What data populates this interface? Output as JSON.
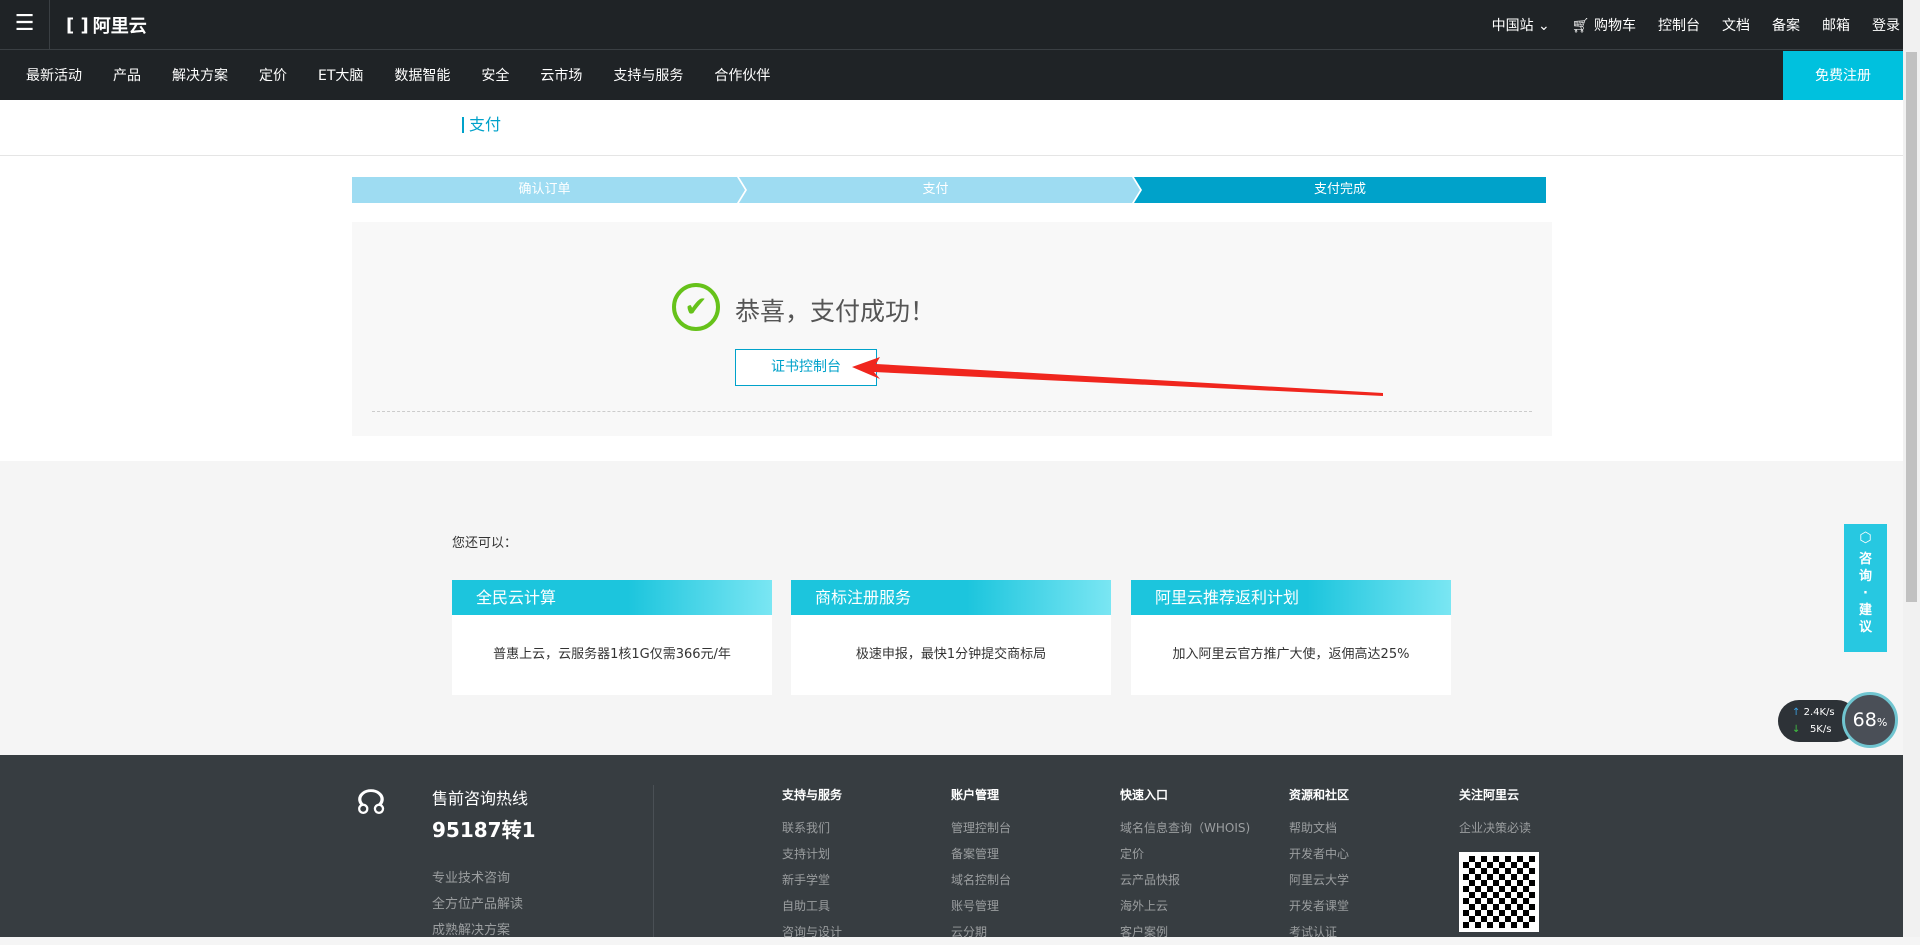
{
  "header": {
    "brand": "阿里云",
    "right_items": [
      "中国站",
      "购物车",
      "控制台",
      "文档",
      "备案",
      "邮箱",
      "登录"
    ],
    "nav": [
      "最新活动",
      "产品",
      "解决方案",
      "定价",
      "ET大脑",
      "数据智能",
      "安全",
      "云市场",
      "支持与服务",
      "合作伙伴"
    ],
    "register": "免费注册"
  },
  "page_title": "支付",
  "steps": [
    "确认订单",
    "支付",
    "支付完成"
  ],
  "success": {
    "message": "恭喜，支付成功！",
    "button": "证书控制台"
  },
  "also_label": "您还可以：",
  "cards": [
    {
      "title": "全民云计算",
      "desc": "普惠上云，云服务器1核1G仅需366元/年"
    },
    {
      "title": "商标注册服务",
      "desc": "极速申报，最快1分钟提交商标局"
    },
    {
      "title": "阿里云推荐返利计划",
      "desc": "加入阿里云官方推广大使，返佣高达25%"
    }
  ],
  "footer": {
    "hotline_label": "售前咨询热线",
    "hotline": "95187转1",
    "links": [
      "专业技术咨询",
      "全方位产品解读",
      "成熟解决方案"
    ],
    "columns": [
      {
        "title": "支持与服务",
        "items": [
          "联系我们",
          "支持计划",
          "新手学堂",
          "自助工具",
          "咨询与设计"
        ]
      },
      {
        "title": "账户管理",
        "items": [
          "管理控制台",
          "备案管理",
          "域名控制台",
          "账号管理",
          "云分期"
        ]
      },
      {
        "title": "快速入口",
        "items": [
          "域名信息查询（WHOIS)",
          "定价",
          "云产品快报",
          "海外上云",
          "客户案例"
        ]
      },
      {
        "title": "资源和社区",
        "items": [
          "帮助文档",
          "开发者中心",
          "阿里云大学",
          "开发者课堂",
          "考试认证"
        ]
      },
      {
        "title": "关注阿里云",
        "items": [
          "企业决策必读"
        ]
      }
    ]
  },
  "consult": {
    "line1": "咨",
    "line2": "询",
    "dot": "·",
    "line3": "建",
    "line4": "议"
  },
  "speed": {
    "up": "2.4K/s",
    "down": "5K/s",
    "percent": "68",
    "unit": "%"
  }
}
